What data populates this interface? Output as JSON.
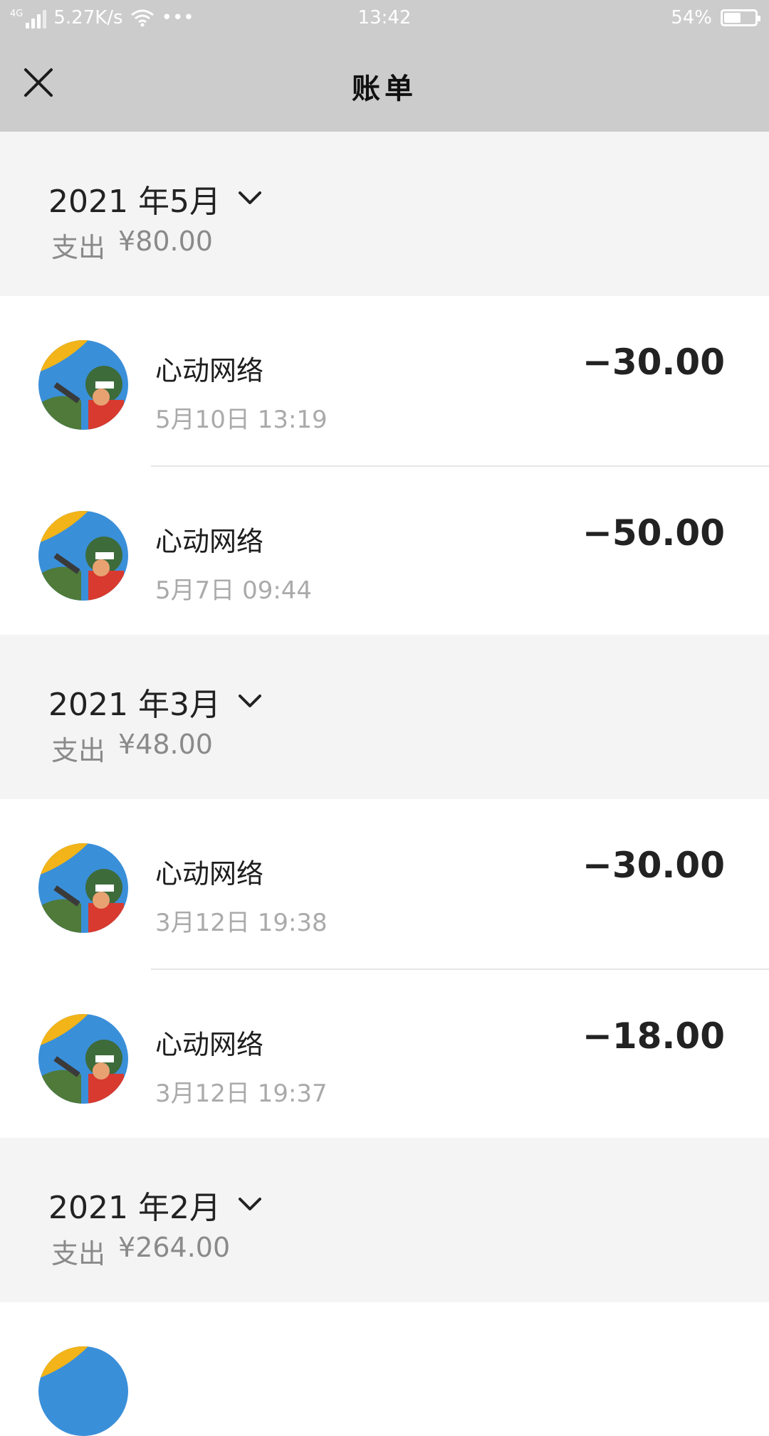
{
  "status_bar": {
    "network": "4G",
    "speed": "5.27K/s",
    "dots": "•••",
    "time": "13:42",
    "battery_text": "54%",
    "battery_level": 0.54
  },
  "header": {
    "title": "账单"
  },
  "months": [
    {
      "label": "2021 年5月",
      "summary_label": "支出",
      "summary_value": "¥80.00",
      "transactions": [
        {
          "merchant": "心动网络",
          "datetime": "5月10日 13:19",
          "amount": "−30.00"
        },
        {
          "merchant": "心动网络",
          "datetime": "5月7日 09:44",
          "amount": "−50.00"
        }
      ]
    },
    {
      "label": "2021 年3月",
      "summary_label": "支出",
      "summary_value": "¥48.00",
      "transactions": [
        {
          "merchant": "心动网络",
          "datetime": "3月12日 19:38",
          "amount": "−30.00"
        },
        {
          "merchant": "心动网络",
          "datetime": "3月12日 19:37",
          "amount": "−18.00"
        }
      ]
    },
    {
      "label": "2021 年2月",
      "summary_label": "支出",
      "summary_value": "¥264.00",
      "transactions": []
    }
  ],
  "icons": {
    "close": "close-icon",
    "expand": "chevron-down-icon",
    "avatar": "merchant-avatar"
  },
  "colors": {
    "titlebar": "#cccccc",
    "month_bg": "#f4f4f4",
    "muted": "#8a8a8a"
  }
}
